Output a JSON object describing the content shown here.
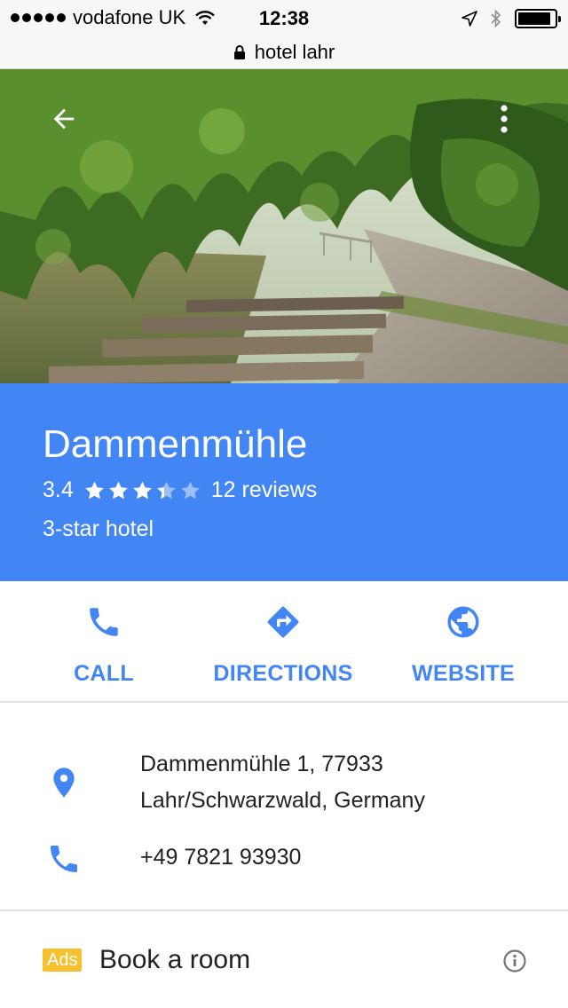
{
  "status_bar": {
    "carrier": "vodafone UK",
    "time": "12:38",
    "battery_level": 0.9
  },
  "browser": {
    "url": "hotel lahr"
  },
  "place": {
    "name": "Dammenmühle",
    "rating": "3.4",
    "rating_value": 3.4,
    "reviews": "12 reviews",
    "category": "3-star hotel"
  },
  "actions": {
    "call": "CALL",
    "directions": "DIRECTIONS",
    "website": "WEBSITE"
  },
  "info": {
    "address_line1": "Dammenmühle 1, 77933",
    "address_line2": "Lahr/Schwarzwald, Germany",
    "phone": "+49 7821 93930"
  },
  "book": {
    "ads_badge": "Ads",
    "label": "Book a room"
  },
  "colors": {
    "accent": "#4285f4",
    "ads": "#f6c02e"
  }
}
